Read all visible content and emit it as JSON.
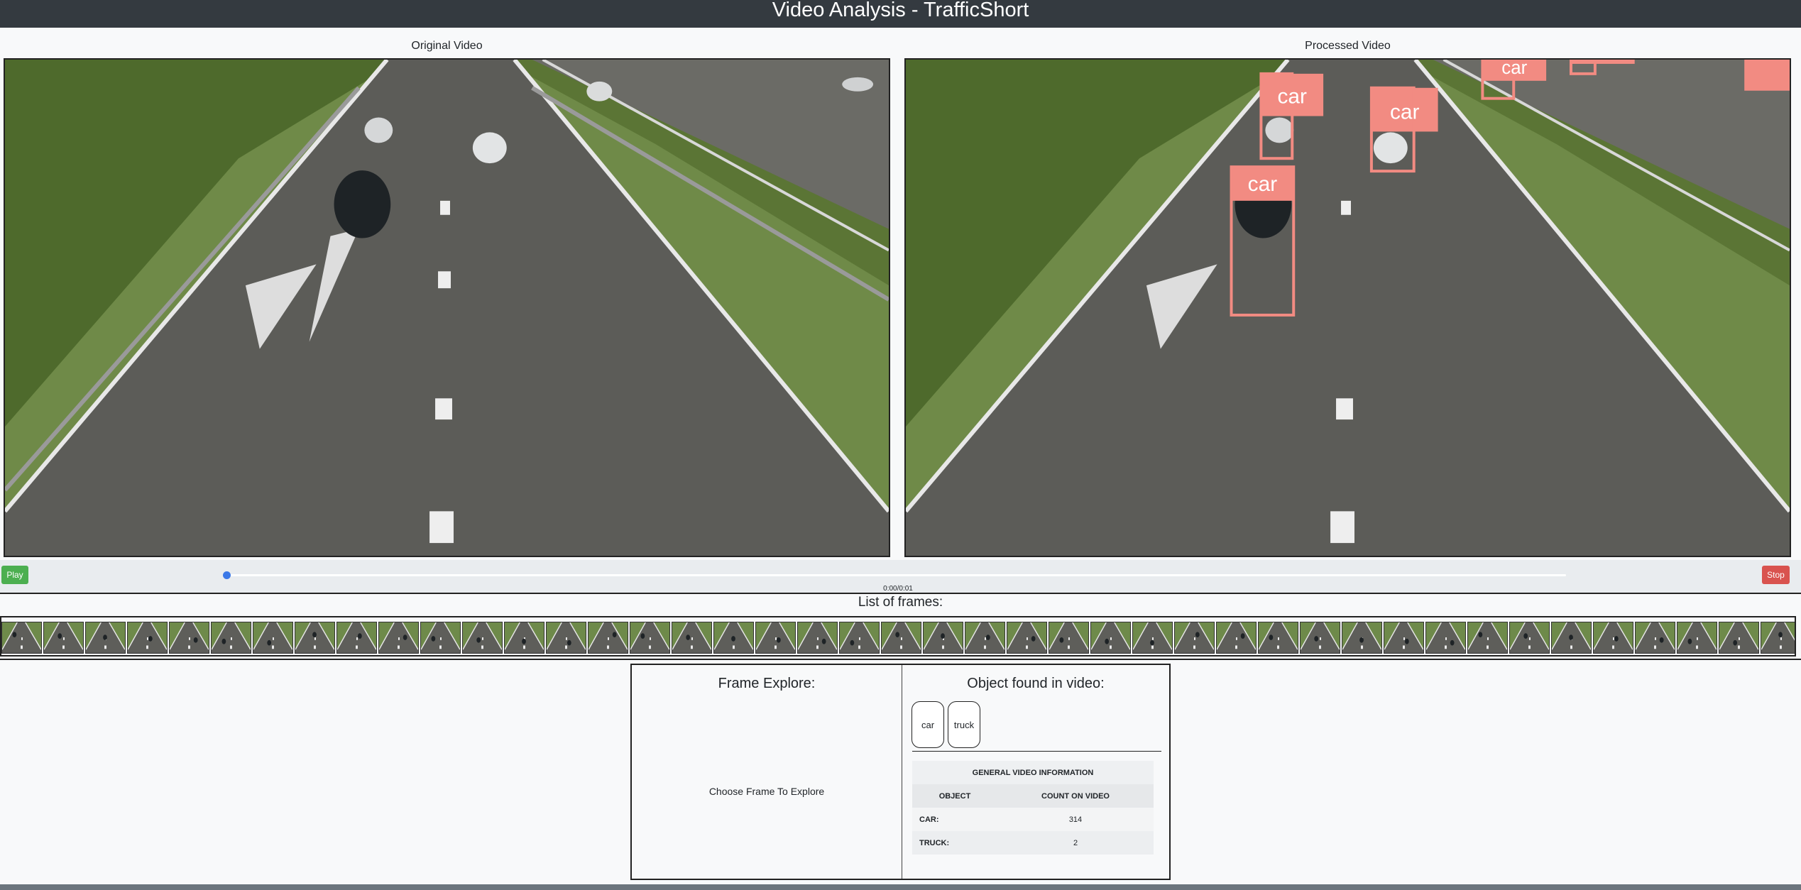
{
  "app": {
    "title": "Video Analysis - TrafficShort"
  },
  "videos": {
    "original_label": "Original Video",
    "processed_label": "Processed Video",
    "detection_label": "car"
  },
  "controls": {
    "play_label": "Play",
    "stop_label": "Stop",
    "time": "0:00/0:01",
    "progress": 0.0
  },
  "frames": {
    "title": "List of frames:",
    "count": 43
  },
  "frame_explore": {
    "title": "Frame Explore:",
    "hint": "Choose Frame To Explore"
  },
  "objects": {
    "title": "Object found in video:",
    "chips": [
      "car",
      "truck"
    ]
  },
  "info_table": {
    "caption": "GENERAL VIDEO INFORMATION",
    "headers": [
      "OBJECT",
      "COUNT ON VIDEO"
    ],
    "rows": [
      {
        "name": "CAR:",
        "count": "314"
      },
      {
        "name": "TRUCK:",
        "count": "2"
      }
    ]
  },
  "colors": {
    "header_bg": "#343a40",
    "play": "#4caf50",
    "stop": "#d9534f",
    "detection_box": "#f28b82",
    "slider_thumb": "#3b78e7"
  }
}
